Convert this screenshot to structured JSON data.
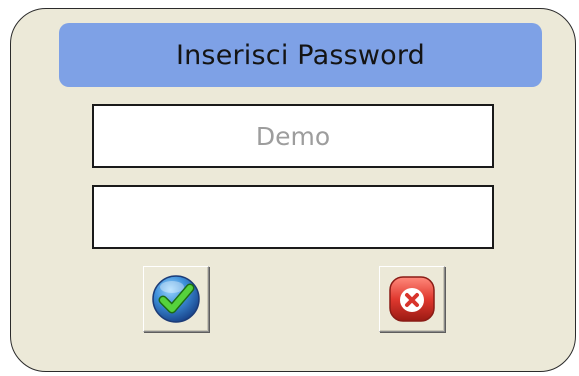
{
  "dialog": {
    "title": "Inserisci Password",
    "username": {
      "value": "Demo"
    },
    "password": {
      "value": ""
    },
    "buttons": {
      "confirm_icon": "check-icon",
      "cancel_icon": "close-icon"
    },
    "colors": {
      "background": "#ece9d8",
      "title_bar": "#7ea1e6",
      "confirm_icon_blue": "#2a76c6",
      "confirm_icon_green": "#3fbf2d",
      "cancel_icon_red": "#d8342c"
    }
  }
}
